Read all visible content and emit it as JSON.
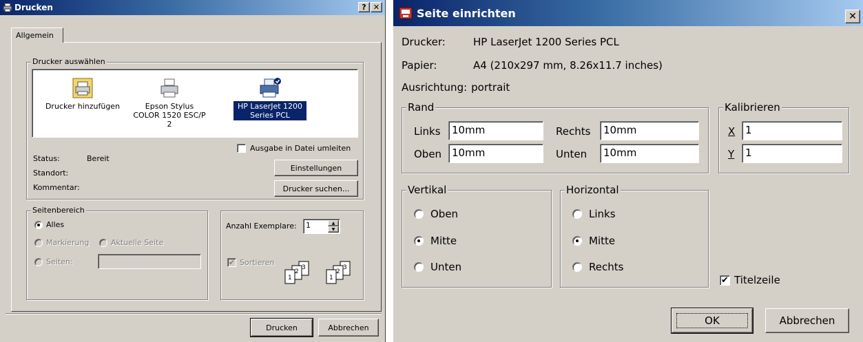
{
  "print_dialog": {
    "title": "Drucken",
    "help_btn": "?",
    "close_btn": "✕",
    "tab": "Allgemein",
    "printer_group": "Drucker auswählen",
    "printers": [
      {
        "label": "Drucker hinzufügen",
        "icon": "add-printer-icon"
      },
      {
        "label": "Epson Stylus COLOR 1520 ESC/P 2",
        "icon": "printer-icon"
      },
      {
        "label": "HP LaserJet 1200 Series PCL",
        "icon": "default-printer-icon",
        "selected": true
      }
    ],
    "status_label": "Status:",
    "status_value": "Bereit",
    "location_label": "Standort:",
    "comment_label": "Kommentar:",
    "print_to_file": "Ausgabe in Datei umleiten",
    "settings_btn": "Einstellungen",
    "find_printer_btn": "Drucker suchen...",
    "page_range_group": "Seitenbereich",
    "all": "Alles",
    "selection": "Markierung",
    "current_page": "Aktuelle Seite",
    "pages": "Seiten:",
    "copies_label": "Anzahl Exemplare:",
    "copies_value": "1",
    "collate": "Sortieren",
    "print_btn": "Drucken",
    "cancel_btn": "Abbrechen"
  },
  "page_setup": {
    "title": "Seite einrichten",
    "close_btn": "✕",
    "printer_label": "Drucker:",
    "printer_value": "HP LaserJet 1200 Series PCL",
    "paper_label": "Papier:",
    "paper_value": "A4 (210x297 mm, 8.26x11.7 inches)",
    "orientation_label": "Ausrichtung:",
    "orientation_value": "portrait",
    "margin_group": "Rand",
    "left_label": "Links",
    "left_value": "10mm",
    "right_label": "Rechts",
    "right_value": "10mm",
    "top_label": "Oben",
    "top_value": "10mm",
    "bottom_label": "Unten",
    "bottom_value": "10mm",
    "calibrate_group": "Kalibrieren",
    "x_label": "X",
    "x_value": "1",
    "y_label": "Y",
    "y_value": "1",
    "vertical_group": "Vertikal",
    "v_top": "Oben",
    "v_middle": "Mitte",
    "v_bottom": "Unten",
    "horizontal_group": "Horizontal",
    "h_left": "Links",
    "h_middle": "Mitte",
    "h_right": "Rechts",
    "title_line": "Titelzeile",
    "ok_btn": "OK",
    "cancel_btn": "Abbrechen"
  }
}
